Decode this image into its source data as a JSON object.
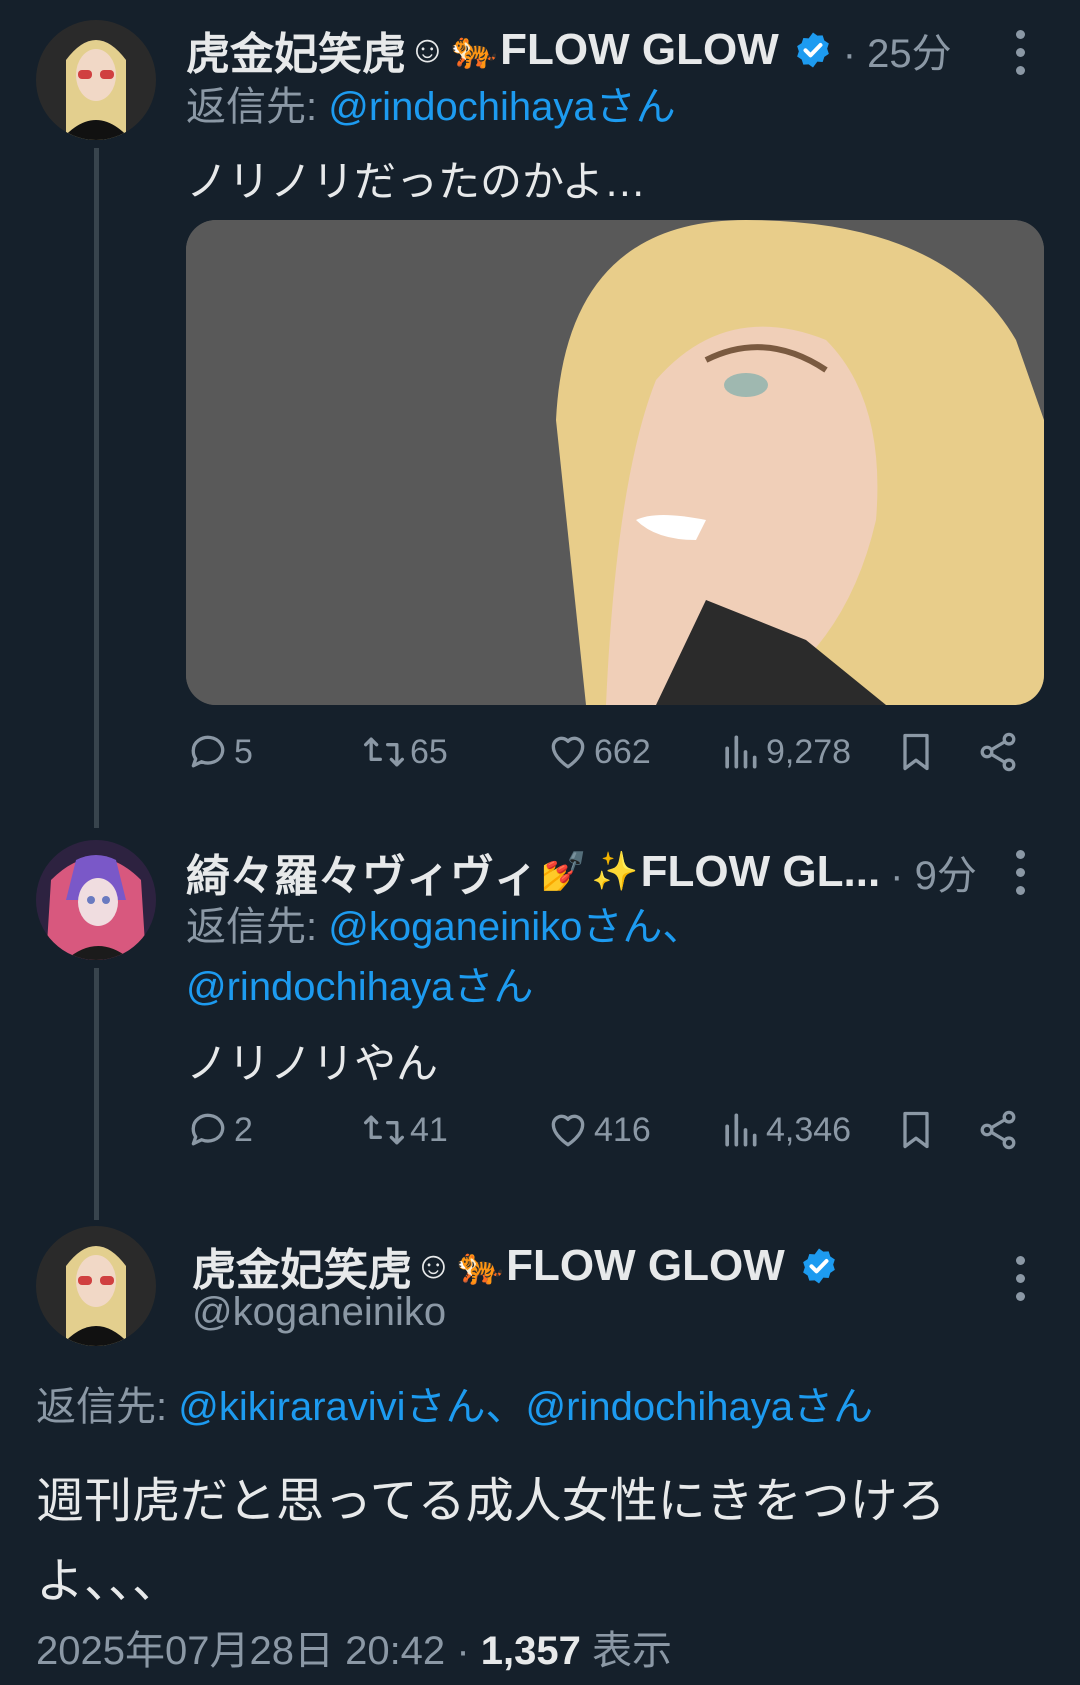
{
  "tweets": [
    {
      "author_name": "虎金妃笑虎",
      "author_suffix": "FLOW GLOW",
      "time": "· 25分",
      "reply_label": "返信先:",
      "reply_mentions": "@rindochihayaさん",
      "text": "ノリノリだったのかよ…",
      "replies": "5",
      "retweets": "65",
      "likes": "662",
      "views": "9,278"
    },
    {
      "author_name": "綺々羅々ヴィヴィ",
      "author_suffix": "FLOW GL...",
      "time": "· 9分",
      "reply_label": "返信先:",
      "reply_mention_1": "@koganeinikoさん、",
      "reply_mention_2": "@rindochihayaさん",
      "text": "ノリノリやん",
      "replies": "2",
      "retweets": "41",
      "likes": "416",
      "views": "4,346"
    }
  ],
  "main_tweet": {
    "author_name": "虎金妃笑虎",
    "author_suffix": "FLOW GLOW",
    "handle": "@koganeiniko",
    "reply_label": "返信先:",
    "reply_mentions": "@kikiraraviviさん、@rindochihayaさん",
    "text_line1": "週刊虎だと思ってる成人女性にきをつけろ",
    "text_line2": "よ、、、",
    "timestamp": "2025年07月28日 20:42",
    "separator": "·",
    "view_count": "1,357",
    "view_label": "表示"
  },
  "icons": [
    "verified-badge-icon",
    "more-icon",
    "reply-icon",
    "retweet-icon",
    "like-icon",
    "views-icon",
    "bookmark-icon",
    "share-icon"
  ],
  "colors": {
    "background": "#15202b",
    "accent": "#1d9bf0",
    "muted": "#8b98a5",
    "text": "#e7e9ea"
  }
}
